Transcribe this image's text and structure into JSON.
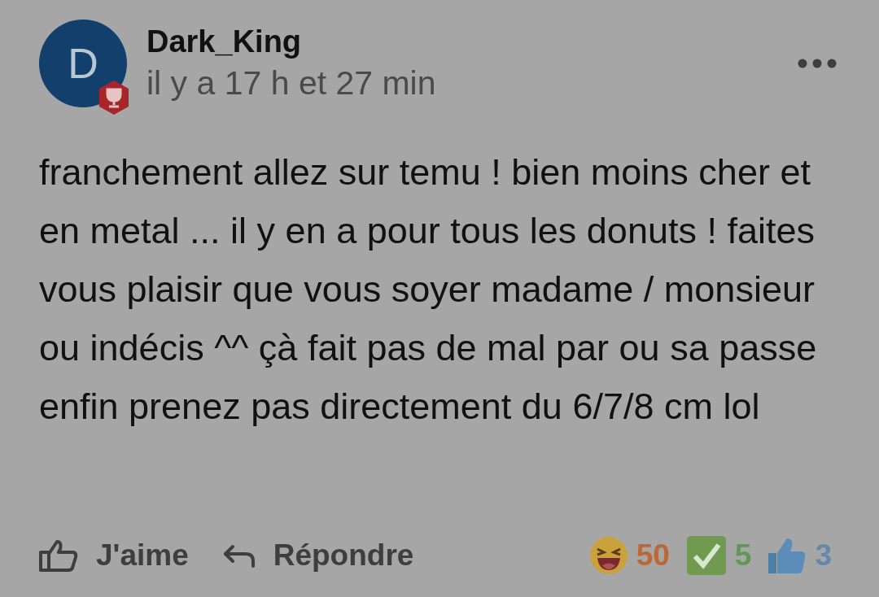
{
  "comment": {
    "author": {
      "initial": "D",
      "name": "Dark_King",
      "badge": true
    },
    "time": "il y a 17 h et 27 min",
    "body": "franchement allez sur temu ! bien moins cher et en metal ... il y en a pour tous les donuts ! faites vous plaisir que vous soyer madame / monsieur ou indécis ^^ çà fait pas de mal par ou sa passe enfin prenez pas directement du 6/7/8 cm lol",
    "actions": [
      {
        "kind": "like",
        "label": "J'aime"
      },
      {
        "kind": "reply",
        "label": "Répondre"
      }
    ],
    "reactions": [
      {
        "kind": "laugh",
        "count": "50",
        "color": "#b8693a"
      },
      {
        "kind": "check",
        "count": "5",
        "color": "#5f9a55"
      },
      {
        "kind": "thumbs",
        "count": "3",
        "color": "#6488aa"
      }
    ]
  }
}
